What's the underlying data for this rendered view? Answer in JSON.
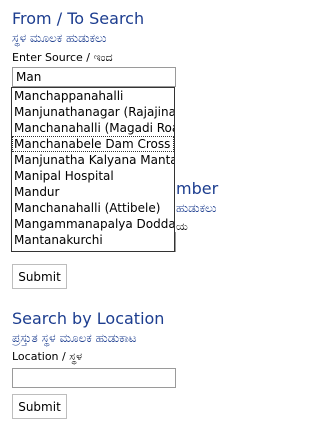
{
  "from_to": {
    "title": "From / To Search",
    "subtitle": "ಸ್ಥಳ ಮೂಲಕ ಹುಡುಕಲು",
    "source_label": "Enter Source / ಇಂದ",
    "source_value": "Man"
  },
  "route_number": {
    "title_partial": "mber",
    "subtitle_partial": "ಹುಡುಕಲು",
    "peek_text": "ಯ",
    "submit_label": "Submit"
  },
  "autocomplete": {
    "items": [
      "Manchappanahalli",
      "Manjunathanagar (Rajajinagar)",
      "Manchanahalli (Magadi Road)",
      "Manchanabele Dam Cross",
      "Manjunatha Kalyana Mantapa",
      "Manipal Hospital",
      "Mandur",
      "Manchanahalli (Attibele)",
      "Mangammanapalya Doddakere",
      "Mantanakurchi"
    ],
    "active_index": 3
  },
  "location": {
    "title": "Search by Location",
    "subtitle": "ಪ್ರಸ್ತುತ ಸ್ಥಳ ಮೂಲಕ ಹುಡುಕಾಟ",
    "label": "Location / ಸ್ಥಳ",
    "value": "",
    "submit_label": "Submit"
  }
}
